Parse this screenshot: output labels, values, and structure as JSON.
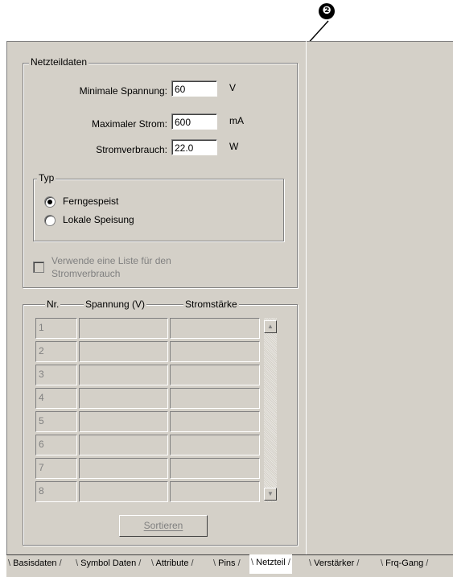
{
  "callout": {
    "number": "❷"
  },
  "netzteil": {
    "group_title": "Netzteildaten",
    "fields": [
      {
        "label": "Minimale Spannung:",
        "value": "60",
        "unit": "V"
      },
      {
        "label": "Maximaler Strom:",
        "value": "600",
        "unit": "mA"
      },
      {
        "label": "Stromverbrauch:",
        "value": "22.0",
        "unit": "W"
      }
    ],
    "typ": {
      "title": "Typ",
      "options": [
        {
          "label": "Ferngespeist",
          "selected": true
        },
        {
          "label": "Lokale Speisung",
          "selected": false
        }
      ]
    },
    "checkbox_label_line1": "Verwende eine Liste für den",
    "checkbox_label_line2": "Stromverbrauch"
  },
  "table": {
    "headers": [
      "Nr.",
      "Spannung (V)",
      "Stromstärke"
    ],
    "rows": [
      "1",
      "2",
      "3",
      "4",
      "5",
      "6",
      "7",
      "8"
    ],
    "sort_button": "Sortieren"
  },
  "tabs": [
    "Basisdaten",
    "Symbol Daten",
    "Attribute",
    "Pins",
    "Netzteil",
    "Verstärker",
    "Frq-Gang"
  ],
  "active_tab": "Netzteil"
}
